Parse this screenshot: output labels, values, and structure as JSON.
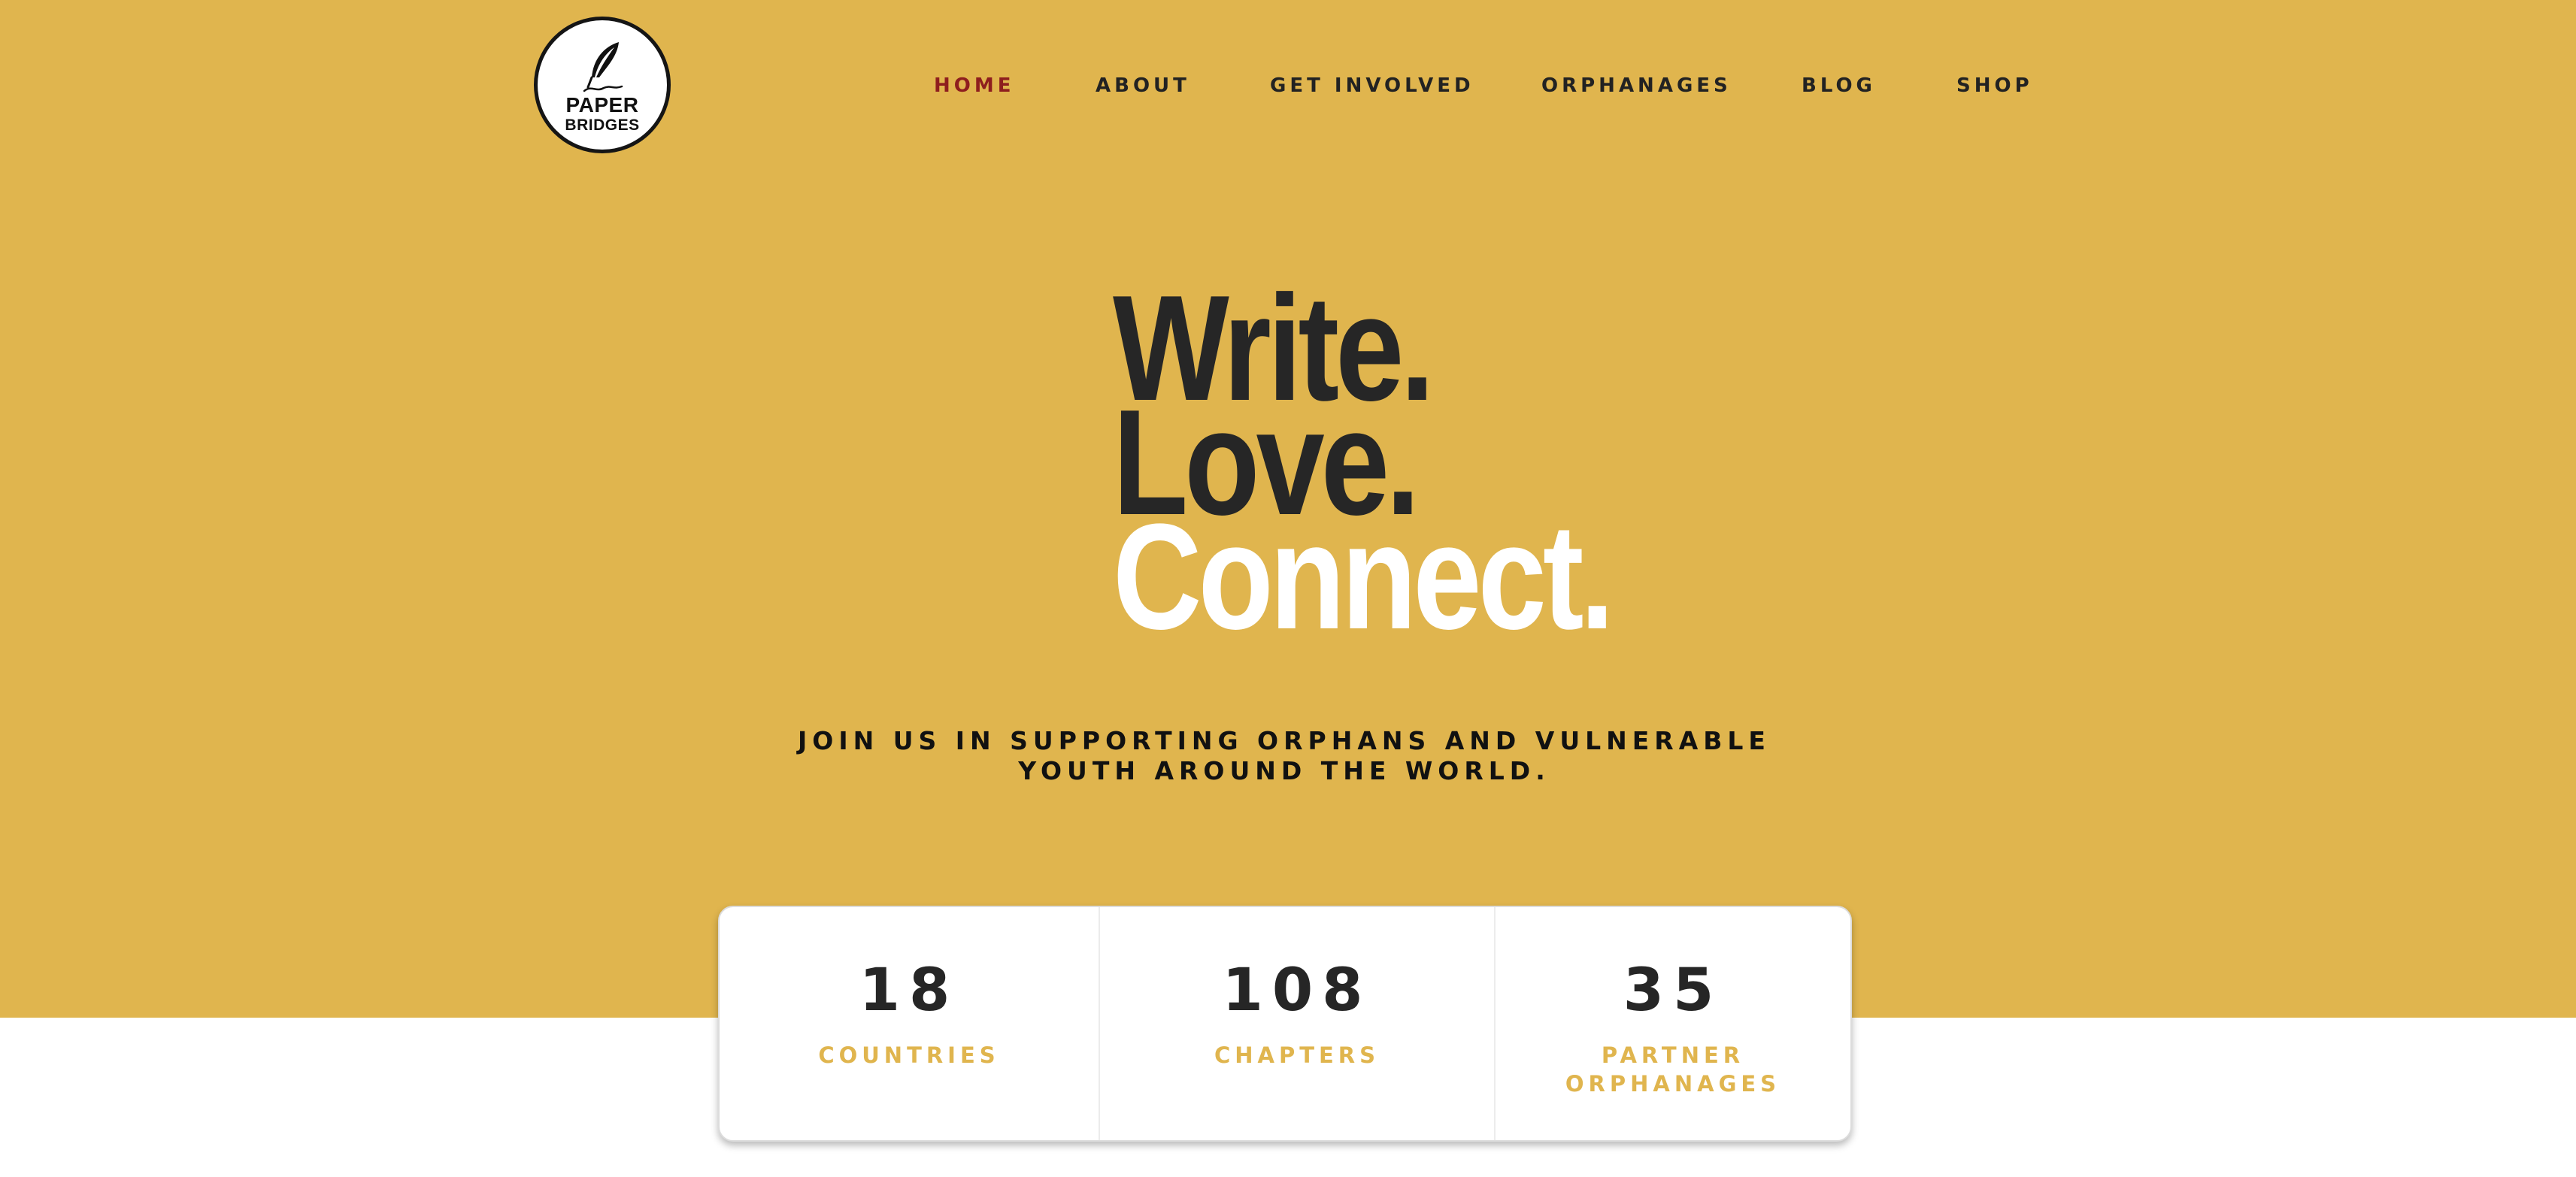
{
  "brand": {
    "name_line1": "PAPER",
    "name_line2": "BRIDGES",
    "logo_icon": "feather-pen-icon"
  },
  "nav": {
    "items": [
      {
        "label": "HOME",
        "active": true
      },
      {
        "label": "ABOUT"
      },
      {
        "label": "GET INVOLVED"
      },
      {
        "label": "ORPHANAGES"
      },
      {
        "label": "BLOG"
      },
      {
        "label": "SHOP"
      }
    ]
  },
  "hero": {
    "headline": [
      "Write.",
      "Love.",
      "Connect."
    ],
    "tagline_line1": "JOIN US IN SUPPORTING ORPHANS AND VULNERABLE",
    "tagline_line2": "YOUTH AROUND THE WORLD."
  },
  "stats": [
    {
      "value": "18",
      "label_line1": "COUNTRIES",
      "label_line2": ""
    },
    {
      "value": "108",
      "label_line1": "CHAPTERS",
      "label_line2": ""
    },
    {
      "value": "35",
      "label_line1": "PARTNER",
      "label_line2": "ORPHANAGES"
    }
  ],
  "colors": {
    "hero_background": "#E0B54E",
    "active_nav": "#8E1E1E",
    "text_dark": "#262626",
    "headline_accent": "#FFFFFF",
    "stat_label": "#E0B54E"
  }
}
